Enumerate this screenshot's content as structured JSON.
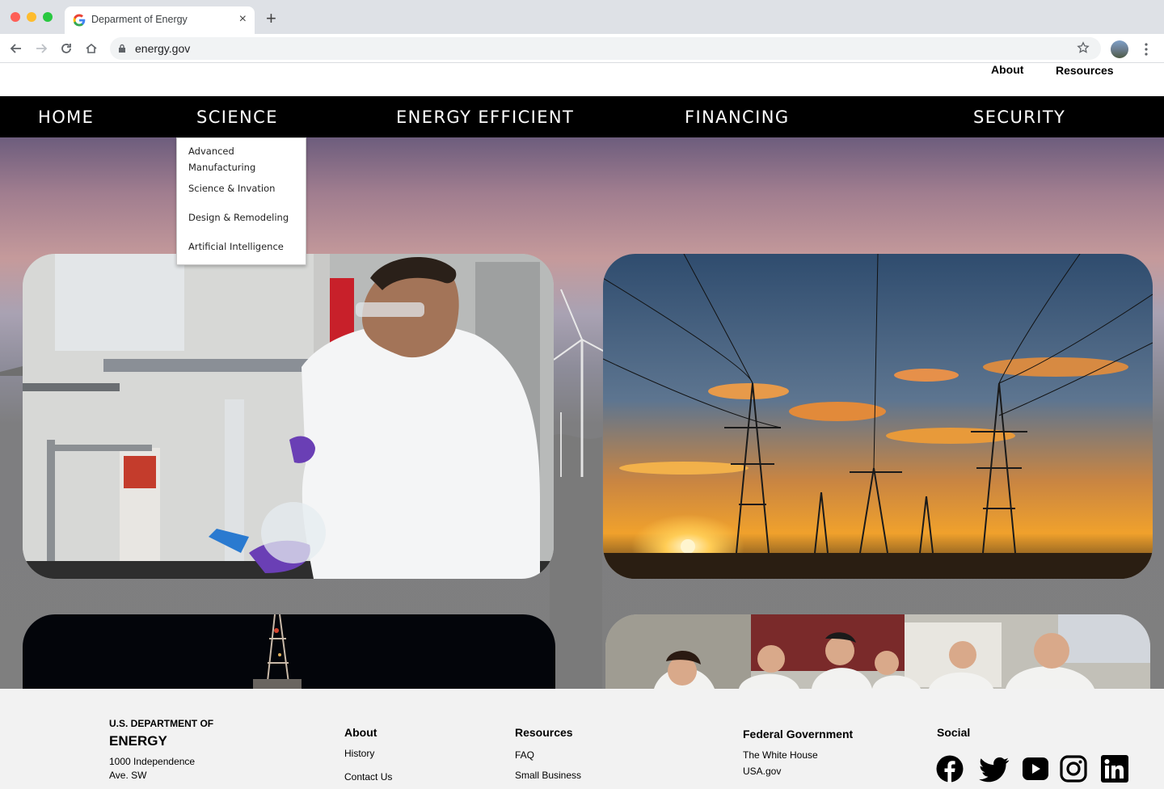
{
  "browser": {
    "tab_title": "Deparment of Energy",
    "new_tab_label": "+",
    "close_label": "×",
    "url": "energy.gov"
  },
  "utility_nav": {
    "about": "About",
    "resources": "Resources"
  },
  "main_nav": [
    "HOME",
    "SCIENCE",
    "ENERGY EFFICIENT",
    "FINANCING",
    "SECURITY"
  ],
  "science_dropdown": [
    "Advanced Manufacturing",
    "Science & Invation",
    "Design & Remodeling",
    "Artificial Intelligence"
  ],
  "footer": {
    "brand_line1": "U.S. DEPARTMENT OF",
    "brand_line2": "ENERGY",
    "address_line1": "1000 Independence",
    "address_line2": "Ave. SW",
    "about": {
      "heading": "About",
      "links": [
        "History",
        "Contact Us"
      ]
    },
    "resources": {
      "heading": "Resources",
      "links": [
        "FAQ",
        "Small Business"
      ]
    },
    "federal": {
      "heading": "Federal Government",
      "links": [
        "The White House",
        "USA.gov"
      ]
    },
    "social": {
      "heading": "Social",
      "icons": [
        "facebook-icon",
        "twitter-icon",
        "youtube-icon",
        "instagram-icon",
        "linkedin-icon"
      ]
    }
  },
  "colors": {
    "nav_bg": "#000000",
    "footer_bg": "#f2f2f2",
    "text": "#000000"
  }
}
